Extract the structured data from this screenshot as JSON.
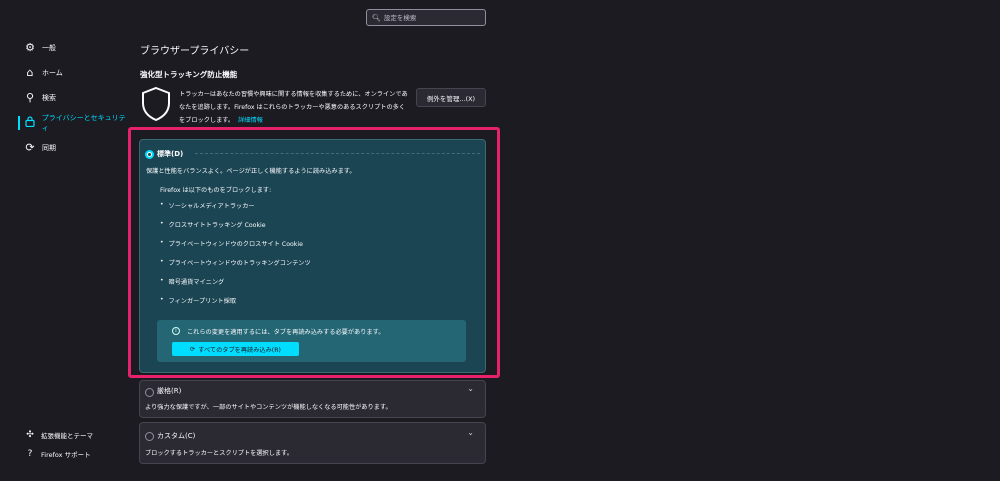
{
  "search": {
    "placeholder": "設定を検索"
  },
  "sidebar": {
    "items": [
      {
        "label": "一般",
        "icon": "gear-icon"
      },
      {
        "label": "ホーム",
        "icon": "home-icon"
      },
      {
        "label": "検索",
        "icon": "search-icon"
      },
      {
        "label": "プライバシーとセキュリティ",
        "icon": "lock-icon",
        "active": true
      },
      {
        "label": "同期",
        "icon": "sync-icon"
      }
    ],
    "bottom": [
      {
        "label": "拡張機能とテーマ",
        "icon": "puzzle-icon"
      },
      {
        "label": "Firefox サポート",
        "icon": "help-icon"
      }
    ]
  },
  "main": {
    "page_title": "ブラウザープライバシー",
    "section_title": "強化型トラッキング防止機能",
    "description": "トラッカーはあなたの習慣や興味に関する情報を収集するために、オンラインであなたを追跡します。Firefox はこれらのトラッカーや悪意のあるスクリプトの多くをブロックします。",
    "learn_more": "詳細情報",
    "exceptions_button": "例外を管理...(X)"
  },
  "standard": {
    "label": "標準(D)",
    "subtitle": "保護と性能をバランスよく。ページが正しく機能するように読み込みます。",
    "blocks_title": "Firefox は以下のものをブロックします:",
    "items": [
      "ソーシャルメディアトラッカー",
      "クロスサイトトラッキング Cookie",
      "プライベートウィンドウのクロスサイト Cookie",
      "プライベートウィンドウのトラッキングコンテンツ",
      "暗号通貨マイニング",
      "フィンガープリント採取"
    ],
    "notice": "これらの変更を適用するには、タブを再読み込みする必要があります。",
    "reload_button": "すべてのタブを再読み込み(R)"
  },
  "strict": {
    "label": "厳格(R)",
    "subtitle": "より強力な保護ですが、一部のサイトやコンテンツが機能しなくなる可能性があります。"
  },
  "custom": {
    "label": "カスタム(C)",
    "subtitle": "ブロックするトラッカーとスクリプトを選択します。"
  },
  "colors": {
    "accent": "#00ddff",
    "highlight": "#e5226b",
    "background": "#1c1b22",
    "card_selected": "#1b4553"
  }
}
